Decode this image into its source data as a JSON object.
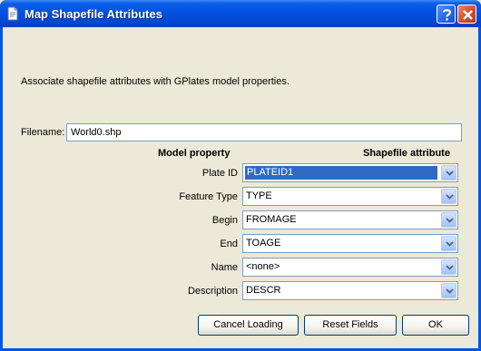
{
  "window": {
    "title": "Map Shapefile Attributes",
    "help_icon": "help-question-icon",
    "close_icon": "close-x-icon",
    "app_icon": "document-icon"
  },
  "intro_text": "Associate shapefile attributes with GPlates model properties.",
  "filename": {
    "label": "Filename:",
    "value": "World0.shp"
  },
  "columns": {
    "model": "Model property",
    "shapefile": "Shapefile attribute"
  },
  "rows": [
    {
      "label": "Plate ID",
      "value": "PLATEID1",
      "selected": true
    },
    {
      "label": "Feature Type",
      "value": "TYPE",
      "selected": false
    },
    {
      "label": "Begin",
      "value": "FROMAGE",
      "selected": false
    },
    {
      "label": "End",
      "value": "TOAGE",
      "selected": false
    },
    {
      "label": "Name",
      "value": "<none>",
      "selected": false
    },
    {
      "label": "Description",
      "value": "DESCR",
      "selected": false
    }
  ],
  "buttons": {
    "cancel": "Cancel Loading",
    "reset": "Reset Fields",
    "ok": "OK"
  },
  "colors": {
    "titlebar": "#0554e3",
    "selection": "#316ac5",
    "dialog_bg": "#ece9d8"
  }
}
